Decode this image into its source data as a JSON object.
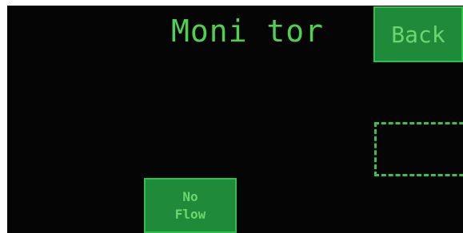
{
  "screen": {
    "title": "Moni tor",
    "back_label": "Back",
    "status_button": {
      "line1": "No",
      "line2": "Flow"
    }
  },
  "colors": {
    "background": "#050505",
    "accent_text": "#4fd04f",
    "button_fill": "#1e8a3a",
    "button_border": "#2fc04a",
    "dashed_outline": "#3cc04a"
  }
}
